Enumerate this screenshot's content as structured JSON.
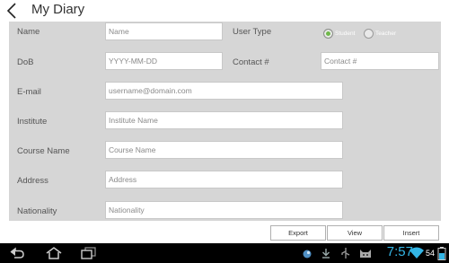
{
  "app": {
    "title": "My Diary"
  },
  "form": {
    "name": {
      "label": "Name",
      "placeholder": "Name"
    },
    "user_type": {
      "label": "User Type",
      "options": [
        {
          "label": "Student",
          "selected": true
        },
        {
          "label": "Teacher",
          "selected": false
        }
      ]
    },
    "dob": {
      "label": "DoB",
      "placeholder": "YYYY-MM-DD"
    },
    "contact": {
      "label": "Contact #",
      "placeholder": "Contact #"
    },
    "email": {
      "label": "E-mail",
      "placeholder": "username@domain.com"
    },
    "institute": {
      "label": "Institute",
      "placeholder": "Institute Name"
    },
    "course": {
      "label": "Course Name",
      "placeholder": "Course Name"
    },
    "address": {
      "label": "Address",
      "placeholder": "Address"
    },
    "nationality": {
      "label": "Nationality",
      "placeholder": "Nationality"
    }
  },
  "actions": {
    "export": "Export",
    "view": "View",
    "insert": "Insert"
  },
  "system_bar": {
    "time": "7:57",
    "battery": "54",
    "accent": "#33b5e5",
    "icons": [
      "back-icon",
      "home-icon",
      "recent-apps-icon",
      "notification-icon",
      "download-icon",
      "cat-icon",
      "usb-icon",
      "wifi-icon",
      "battery-icon"
    ]
  }
}
